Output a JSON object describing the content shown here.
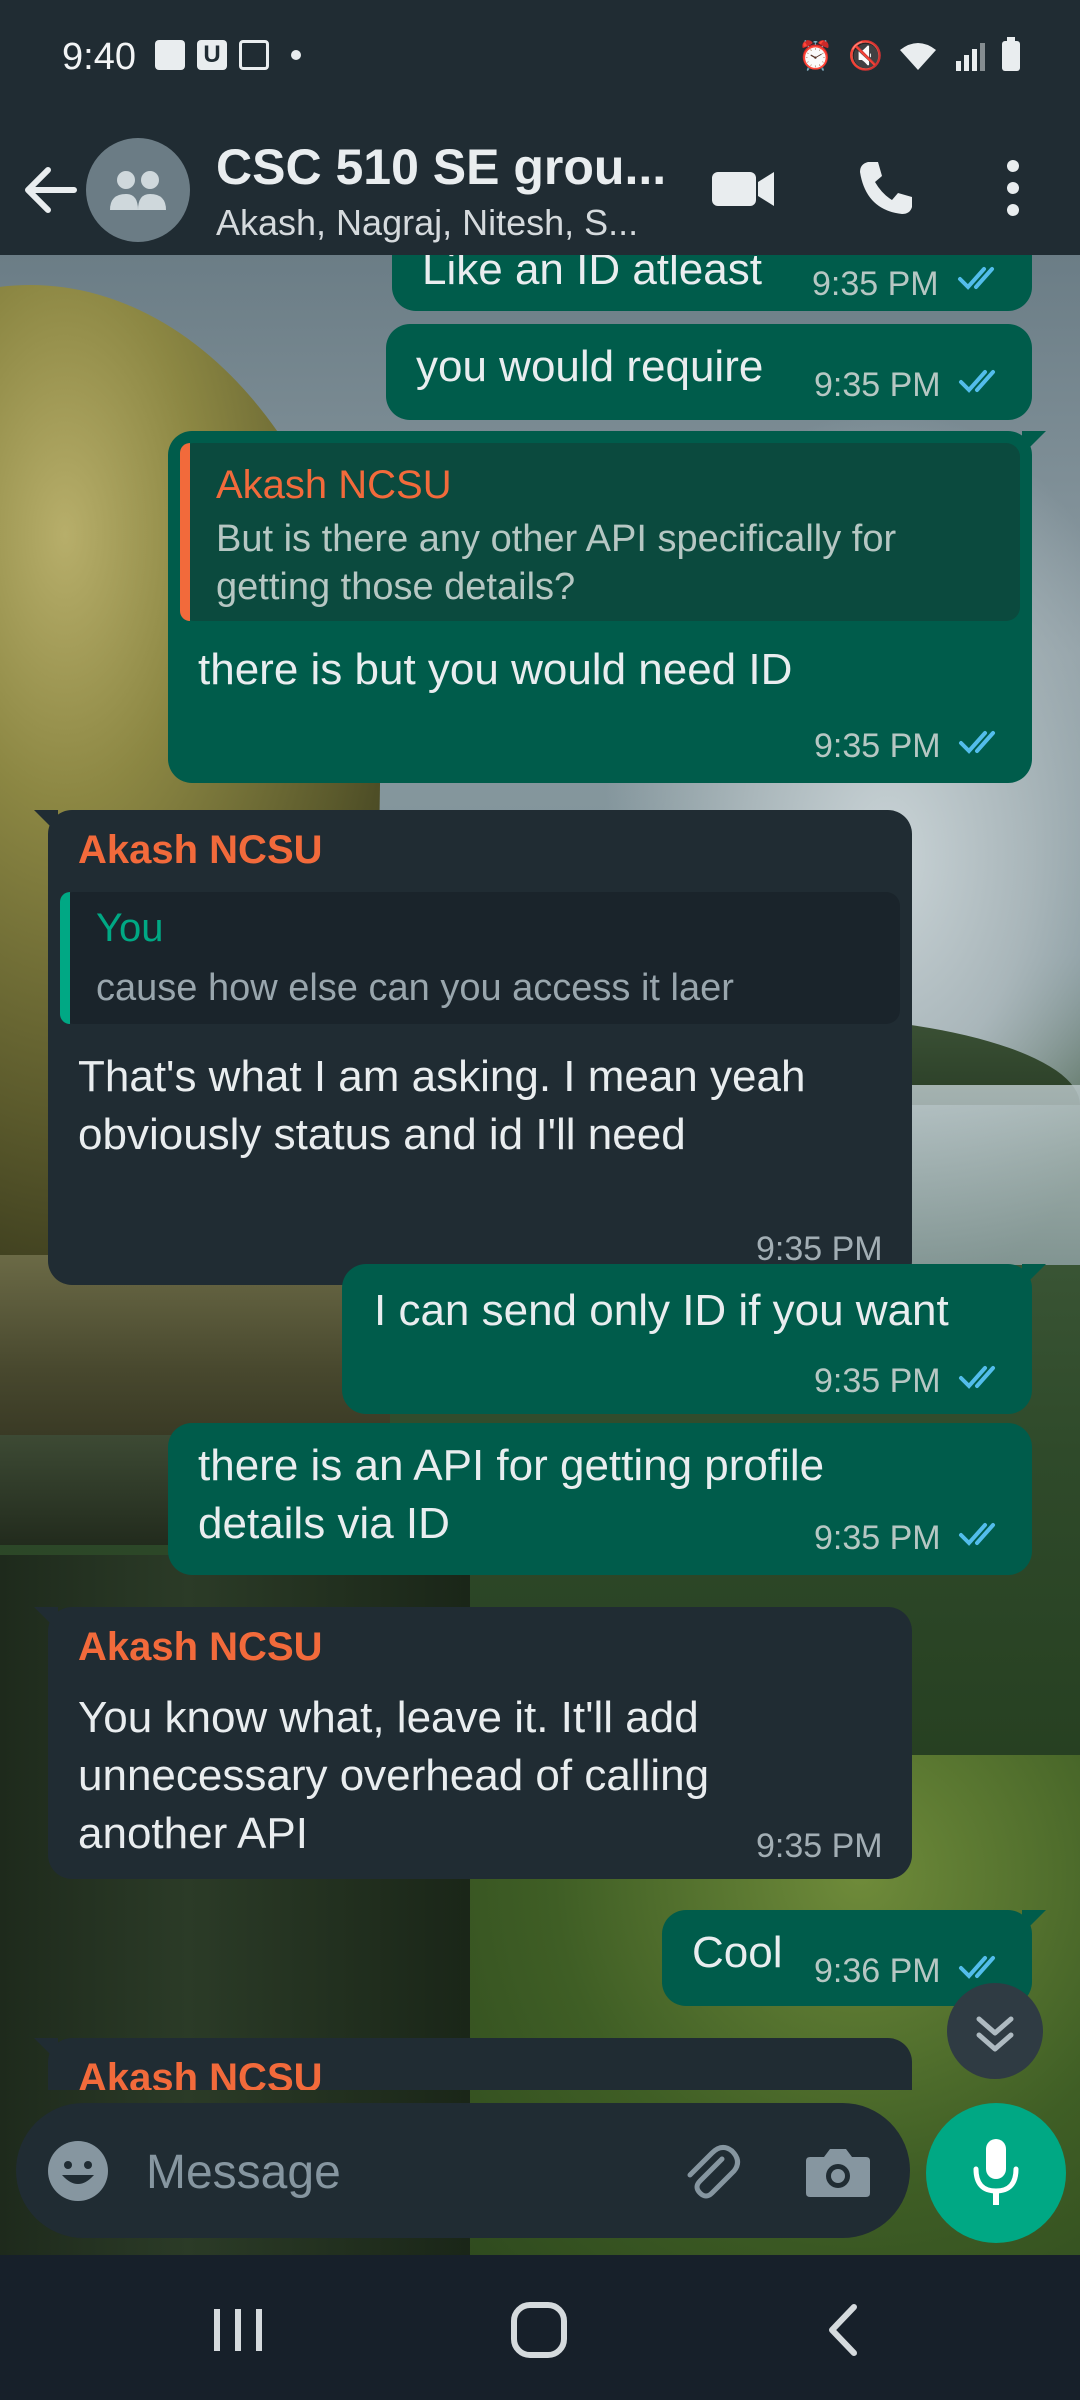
{
  "status_bar": {
    "time": "9:40",
    "left_icons": [
      "gallery-icon",
      "u-app-icon",
      "signature-icon"
    ],
    "right_icons": [
      "alarm-icon",
      "mute-icon",
      "wifi-icon",
      "signal-icon",
      "battery-icon"
    ]
  },
  "header": {
    "title": "CSC 510 SE grou...",
    "subtitle": "Akash, Nagraj, Nitesh, S...",
    "avatar_icon": "group-icon",
    "actions": [
      "video-call-icon",
      "voice-call-icon",
      "more-options-icon"
    ]
  },
  "messages": [
    {
      "direction": "out",
      "text": "Like an ID atleast",
      "time": "9:35 PM",
      "read": true
    },
    {
      "direction": "out",
      "text": "you would require",
      "time": "9:35 PM",
      "read": true
    },
    {
      "direction": "out",
      "reply_to": {
        "sender": "Akash NCSU",
        "text": "But is there any other API specifically for getting those details?"
      },
      "text": "there is but you would need ID",
      "time": "9:35 PM",
      "read": true
    },
    {
      "direction": "in",
      "sender": "Akash NCSU",
      "reply_to": {
        "sender": "You",
        "text": "cause how else can you access it laer"
      },
      "text": "That's what I am asking. I mean yeah obviously status and id I'll need",
      "time": "9:35 PM"
    },
    {
      "direction": "out",
      "text": "I can send only ID if you want",
      "time": "9:35 PM",
      "read": true
    },
    {
      "direction": "out",
      "text": "there is an API for getting profile details via ID",
      "time": "9:35 PM",
      "read": true
    },
    {
      "direction": "in",
      "sender": "Akash NCSU",
      "text": "You know what, leave it. It'll add unnecessary overhead of calling another API",
      "time": "9:35 PM"
    },
    {
      "direction": "out",
      "text": "Cool",
      "time": "9:36 PM",
      "read": true
    },
    {
      "direction": "in",
      "sender": "Akash NCSU",
      "text": "",
      "time": ""
    }
  ],
  "composer": {
    "placeholder": "Message",
    "icons": [
      "emoji-icon",
      "attach-icon",
      "camera-icon",
      "mic-icon"
    ]
  },
  "colors": {
    "header_bg": "#202c33",
    "outgoing_bubble": "#005c4b",
    "incoming_bubble": "#202c33",
    "accent_green": "#00a884",
    "sender_name": "#f26a3b",
    "read_ticks": "#53bdeb"
  },
  "nav_bar": {
    "buttons": [
      "recents-icon",
      "home-icon",
      "back-nav-icon"
    ]
  }
}
